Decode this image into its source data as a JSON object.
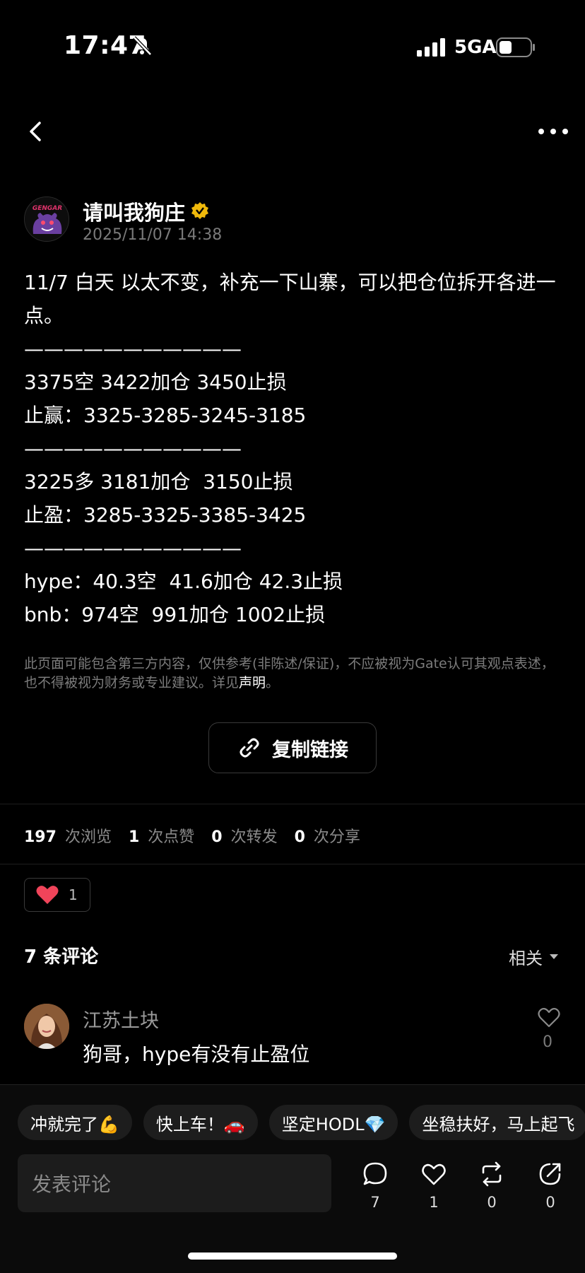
{
  "status_bar": {
    "time": "17:47",
    "network": "5GA",
    "icons": [
      "bell-slash-icon",
      "signal-icon",
      "battery-icon"
    ]
  },
  "nav": {
    "back_icon": "chevron-left-icon",
    "more_icon": "more-dots-icon"
  },
  "post": {
    "author": "请叫我狗庄",
    "verified_badge": "verified-icon",
    "datetime": "2025/11/07 14:38",
    "lines": [
      "11/7 白天  以太不变，补充一下山寨，可以把仓位拆开各进一点。",
      "———————————",
      "3375空 3422加仓 3450止损",
      "止赢：3325-3285-3245-3185",
      "———————————",
      "3225多 3181加仓  3150止损",
      "止盈：3285-3325-3385-3425",
      "———————————",
      "hype：40.3空  41.6加仓 42.3止损",
      "bnb：974空  991加仓 1002止损"
    ],
    "disclaimer": "此页面可能包含第三方内容，仅供参考(非陈述/保证)，不应被视为Gate认可其观点表述，也不得被视为财务或专业建议。详见",
    "disclaimer_link": "声明",
    "disclaimer_end": "。",
    "copy_link_label": "复制链接"
  },
  "stats": {
    "views": "197",
    "views_label": "次浏览",
    "likes": "1",
    "likes_label": "次点赞",
    "reposts": "0",
    "reposts_label": "次转发",
    "shares": "0",
    "shares_label": "次分享"
  },
  "reaction": {
    "icon": "heart-icon",
    "count": "1",
    "color": "#f0445a"
  },
  "comments": {
    "title": "7 条评论",
    "sort_label": "相关",
    "items": [
      {
        "name": "江苏土块",
        "text": "狗哥，hype有没有止盈位",
        "likes": "0"
      }
    ]
  },
  "quick_replies": [
    "冲就完了💪",
    "快上车！🚗",
    "坚定HODL💎",
    "坐稳扶好，马上起飞"
  ],
  "composer": {
    "placeholder": "发表评论",
    "actions": [
      {
        "icon": "comment-icon",
        "count": "7"
      },
      {
        "icon": "heart-outline-icon",
        "count": "1"
      },
      {
        "icon": "repost-icon",
        "count": "0"
      },
      {
        "icon": "share-icon",
        "count": "0"
      }
    ]
  }
}
